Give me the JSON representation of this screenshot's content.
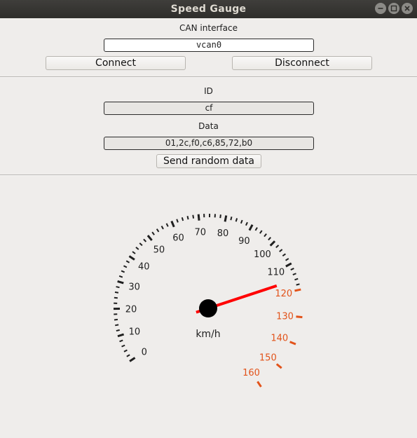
{
  "window": {
    "title": "Speed Gauge"
  },
  "can_section": {
    "label": "CAN interface",
    "interface_value": "vcan0",
    "connect_label": "Connect",
    "disconnect_label": "Disconnect"
  },
  "data_section": {
    "id_label": "ID",
    "id_value": "cf",
    "data_label": "Data",
    "data_value": "01,2c,f0,c6,85,72,b0",
    "send_label": "Send random data"
  },
  "gauge": {
    "unit": "km/h",
    "min": 0,
    "max": 160,
    "current_value": 116,
    "redline_start": 120,
    "labels": [
      "0",
      "10",
      "20",
      "30",
      "40",
      "50",
      "60",
      "70",
      "80",
      "90",
      "100",
      "110",
      "120",
      "130",
      "140",
      "150",
      "160"
    ],
    "colors": {
      "normal": "#1f1f1f",
      "redline": "#e2531a",
      "needle": "#ff0000",
      "hub": "#000000"
    }
  }
}
